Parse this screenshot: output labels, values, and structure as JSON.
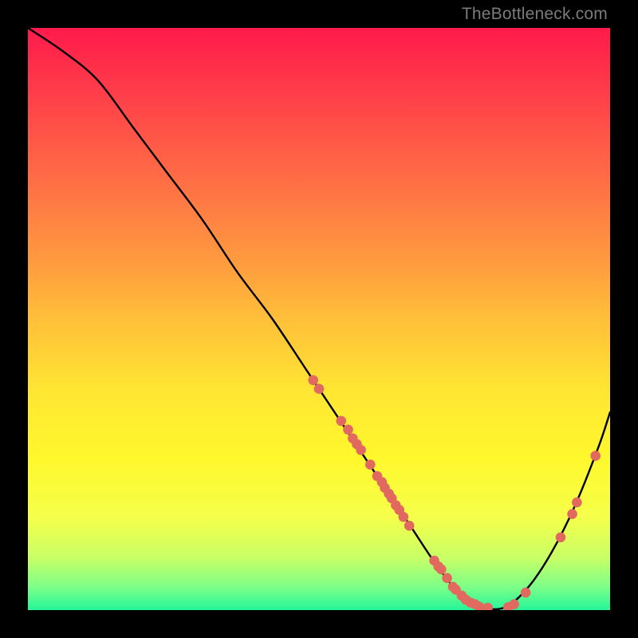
{
  "watermark": "TheBottleneck.com",
  "colors": {
    "curve": "#000000",
    "dots": "#e2695f",
    "gradient_top": "#ff1a4b",
    "gradient_mid": "#ffe533",
    "gradient_bottom": "#25f59a",
    "page_bg": "#000000"
  },
  "chart_data": {
    "type": "line",
    "title": "",
    "xlabel": "",
    "ylabel": "",
    "xlim": [
      0,
      100
    ],
    "ylim": [
      0,
      100
    ],
    "series": [
      {
        "name": "bottleneck-curve",
        "x": [
          0,
          6,
          12,
          18,
          24,
          30,
          36,
          42,
          48,
          54,
          58,
          62,
          66,
          70,
          74,
          78,
          82,
          86,
          90,
          94,
          98,
          100
        ],
        "y": [
          100,
          96,
          91,
          83,
          75,
          67,
          58,
          50,
          41,
          32,
          26,
          20,
          14,
          8,
          3,
          0.5,
          0.5,
          4,
          10,
          18,
          28,
          34
        ]
      }
    ],
    "dots": [
      {
        "x": 49.0,
        "y": 39.5
      },
      {
        "x": 50.0,
        "y": 38.0
      },
      {
        "x": 53.8,
        "y": 32.5
      },
      {
        "x": 55.0,
        "y": 31.0
      },
      {
        "x": 55.8,
        "y": 29.5
      },
      {
        "x": 56.5,
        "y": 28.5
      },
      {
        "x": 57.2,
        "y": 27.5
      },
      {
        "x": 58.8,
        "y": 25.0
      },
      {
        "x": 60.0,
        "y": 23.0
      },
      {
        "x": 60.8,
        "y": 22.0
      },
      {
        "x": 61.3,
        "y": 21.0
      },
      {
        "x": 62.0,
        "y": 20.0
      },
      {
        "x": 62.5,
        "y": 19.2
      },
      {
        "x": 63.2,
        "y": 18.0
      },
      {
        "x": 63.8,
        "y": 17.2
      },
      {
        "x": 64.5,
        "y": 16.0
      },
      {
        "x": 65.5,
        "y": 14.5
      },
      {
        "x": 69.8,
        "y": 8.5
      },
      {
        "x": 70.5,
        "y": 7.5
      },
      {
        "x": 71.0,
        "y": 7.0
      },
      {
        "x": 72.0,
        "y": 5.5
      },
      {
        "x": 73.0,
        "y": 4.0
      },
      {
        "x": 73.5,
        "y": 3.5
      },
      {
        "x": 74.5,
        "y": 2.5
      },
      {
        "x": 75.2,
        "y": 1.8
      },
      {
        "x": 76.0,
        "y": 1.3
      },
      {
        "x": 76.8,
        "y": 1.0
      },
      {
        "x": 77.5,
        "y": 0.6
      },
      {
        "x": 79.0,
        "y": 0.4
      },
      {
        "x": 82.5,
        "y": 0.5
      },
      {
        "x": 83.5,
        "y": 1.0
      },
      {
        "x": 85.5,
        "y": 3.0
      },
      {
        "x": 91.5,
        "y": 12.5
      },
      {
        "x": 93.5,
        "y": 16.5
      },
      {
        "x": 94.3,
        "y": 18.5
      },
      {
        "x": 97.5,
        "y": 26.5
      }
    ]
  }
}
